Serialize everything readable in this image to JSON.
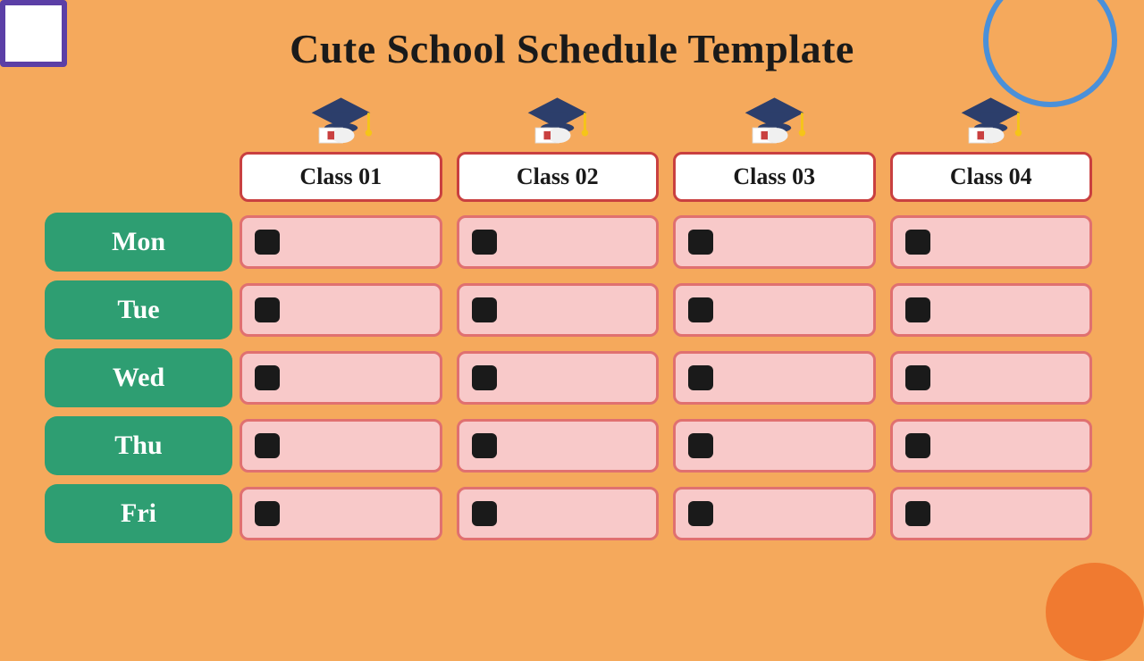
{
  "page": {
    "title": "Cute School Schedule Template",
    "background_color": "#F5A95C"
  },
  "classes": [
    {
      "id": "class-01",
      "label": "Class 01"
    },
    {
      "id": "class-02",
      "label": "Class 02"
    },
    {
      "id": "class-03",
      "label": "Class 03"
    },
    {
      "id": "class-04",
      "label": "Class 04"
    }
  ],
  "days": [
    {
      "id": "header",
      "label": ""
    },
    {
      "id": "mon",
      "label": "Mon"
    },
    {
      "id": "tue",
      "label": "Tue"
    },
    {
      "id": "wed",
      "label": "Wed"
    },
    {
      "id": "thu",
      "label": "Thu"
    },
    {
      "id": "fri",
      "label": "Fri"
    }
  ]
}
